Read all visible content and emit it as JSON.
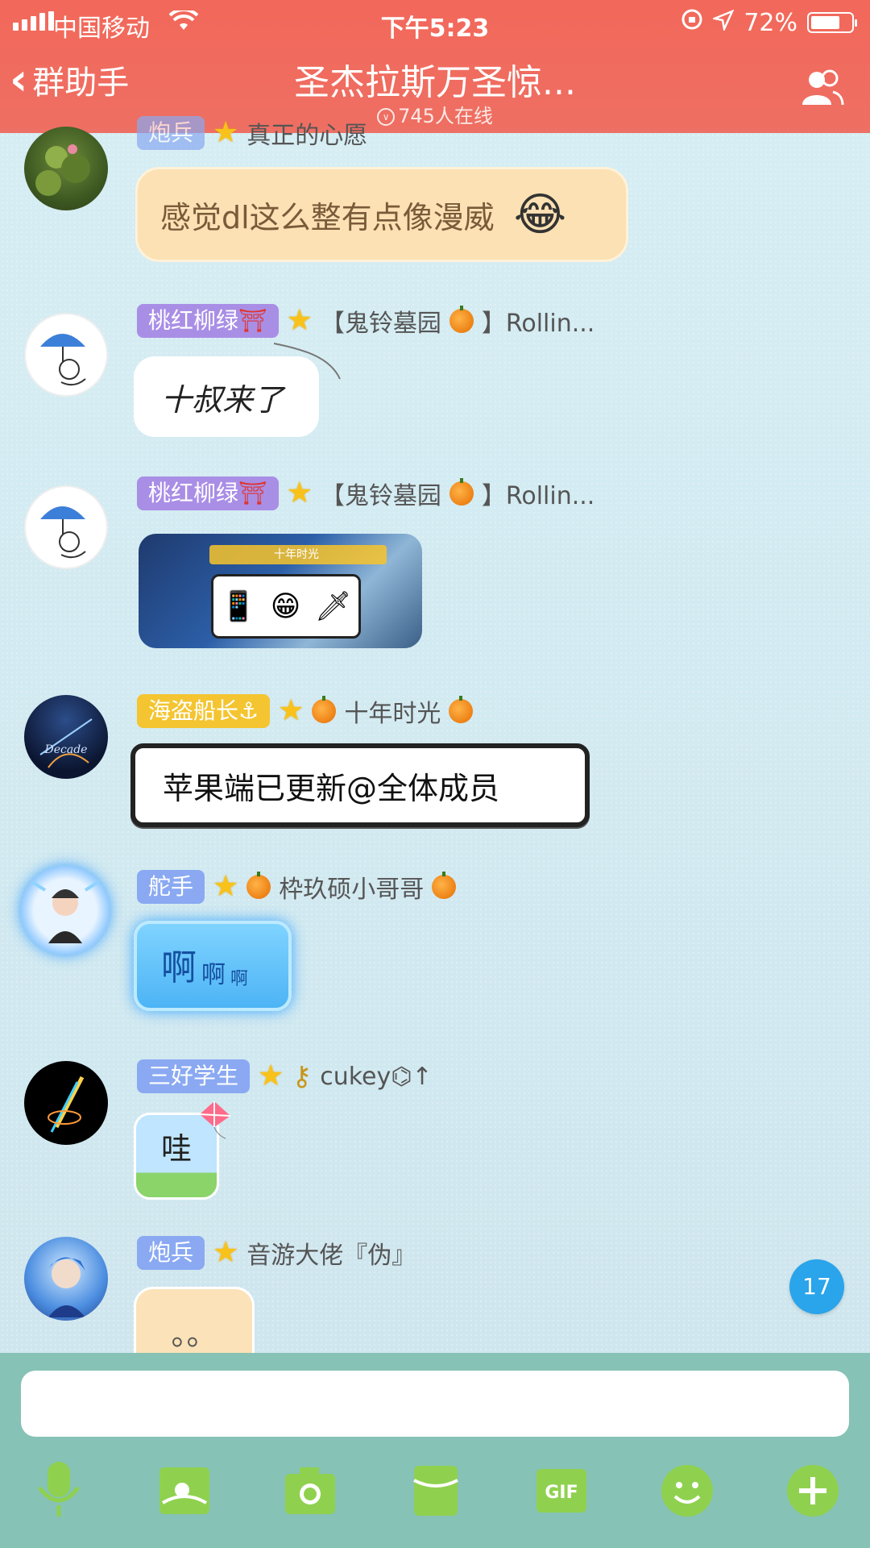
{
  "status": {
    "carrier": "中国移动",
    "time": "下午5:23",
    "battery": "72%",
    "battery_level": 0.72
  },
  "nav": {
    "back_label": "群助手",
    "title": "圣杰拉斯万圣惊...",
    "online": "745人在线"
  },
  "messages": [
    {
      "text": "感觉dl这么整有点像漫威",
      "emoji": "😂",
      "partial_tag": "炮兵",
      "partial_title": "真正的心愿"
    },
    {
      "tag": "桃红柳绿",
      "tag_icon": "⛩",
      "title_left": "【鬼铃墓园",
      "title_right": "】Rollin...",
      "text": "十叔来了"
    },
    {
      "tag": "桃红柳绿",
      "tag_icon": "⛩",
      "title_left": "【鬼铃墓园",
      "title_right": "】Rollin...",
      "image_caption": "十年时光"
    },
    {
      "tag": "海盗船长",
      "tag_icon": "⚓",
      "title": "十年时光",
      "text": "苹果端已更新@全体成员"
    },
    {
      "tag": "舵手",
      "title": "枠玖硕小哥哥",
      "text_big": "啊",
      "text_mid": "啊",
      "text_small": "啊"
    },
    {
      "tag": "三好学生",
      "title": "cukey⌬↑",
      "text": "哇"
    },
    {
      "tag": "炮兵",
      "title": "音游大佬『伪』",
      "text": "。。"
    }
  ],
  "unread_count": "17",
  "input": {
    "placeholder": ""
  },
  "toolbar": [
    "mic-icon",
    "photo-icon",
    "camera-icon",
    "red-packet-icon",
    "gif-icon",
    "emoji-icon",
    "plus-icon"
  ],
  "toolbar_gif_label": "GIF",
  "colors": {
    "header": "#ef6a5e",
    "bottom_bar": "#86c2b5",
    "tool_icon": "#8fd14f",
    "unread_badge": "#2aa4ea"
  }
}
